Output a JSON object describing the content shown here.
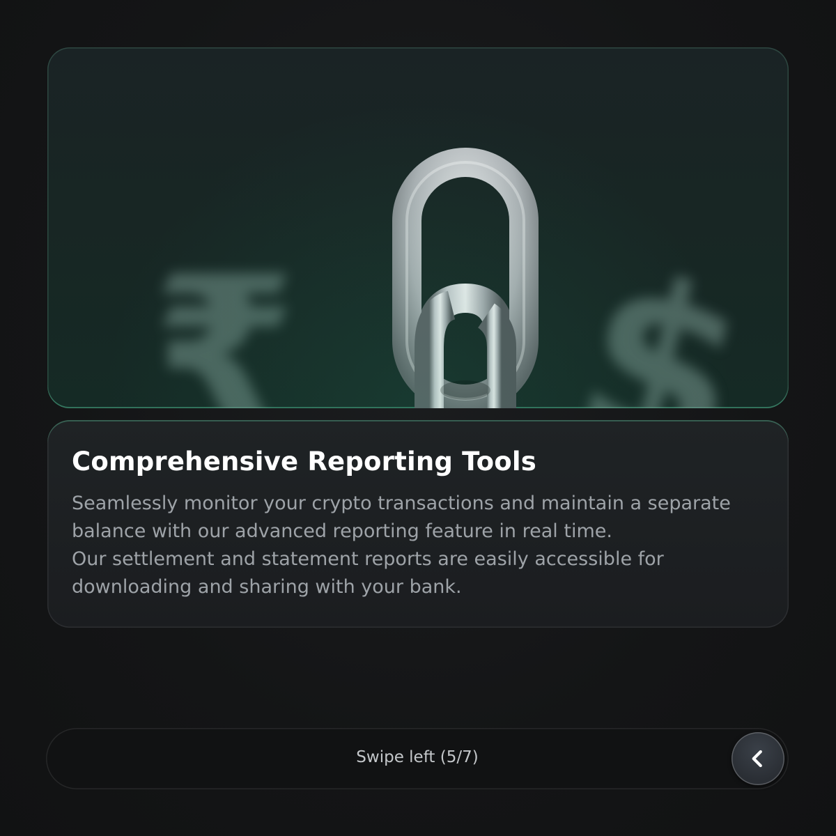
{
  "hero": {
    "image_alt": "silver chain links with blurred rupee and dollar symbols",
    "blur_symbols": [
      "₹",
      "$"
    ]
  },
  "card": {
    "title": "Comprehensive Reporting Tools",
    "body_lines": [
      "Seamlessly monitor your crypto transactions and maintain a separate",
      "balance with our advanced reporting feature in real time.",
      "Our settlement and statement reports are easily accessible for",
      "downloading and sharing with your bank."
    ]
  },
  "swipe": {
    "label": "Swipe left (5/7)",
    "button_icon": "chevron-left-icon"
  },
  "colors": {
    "background": "#141516",
    "accent_green": "#46c896",
    "title_text": "#ffffff",
    "body_text": "#9ea3a8"
  }
}
